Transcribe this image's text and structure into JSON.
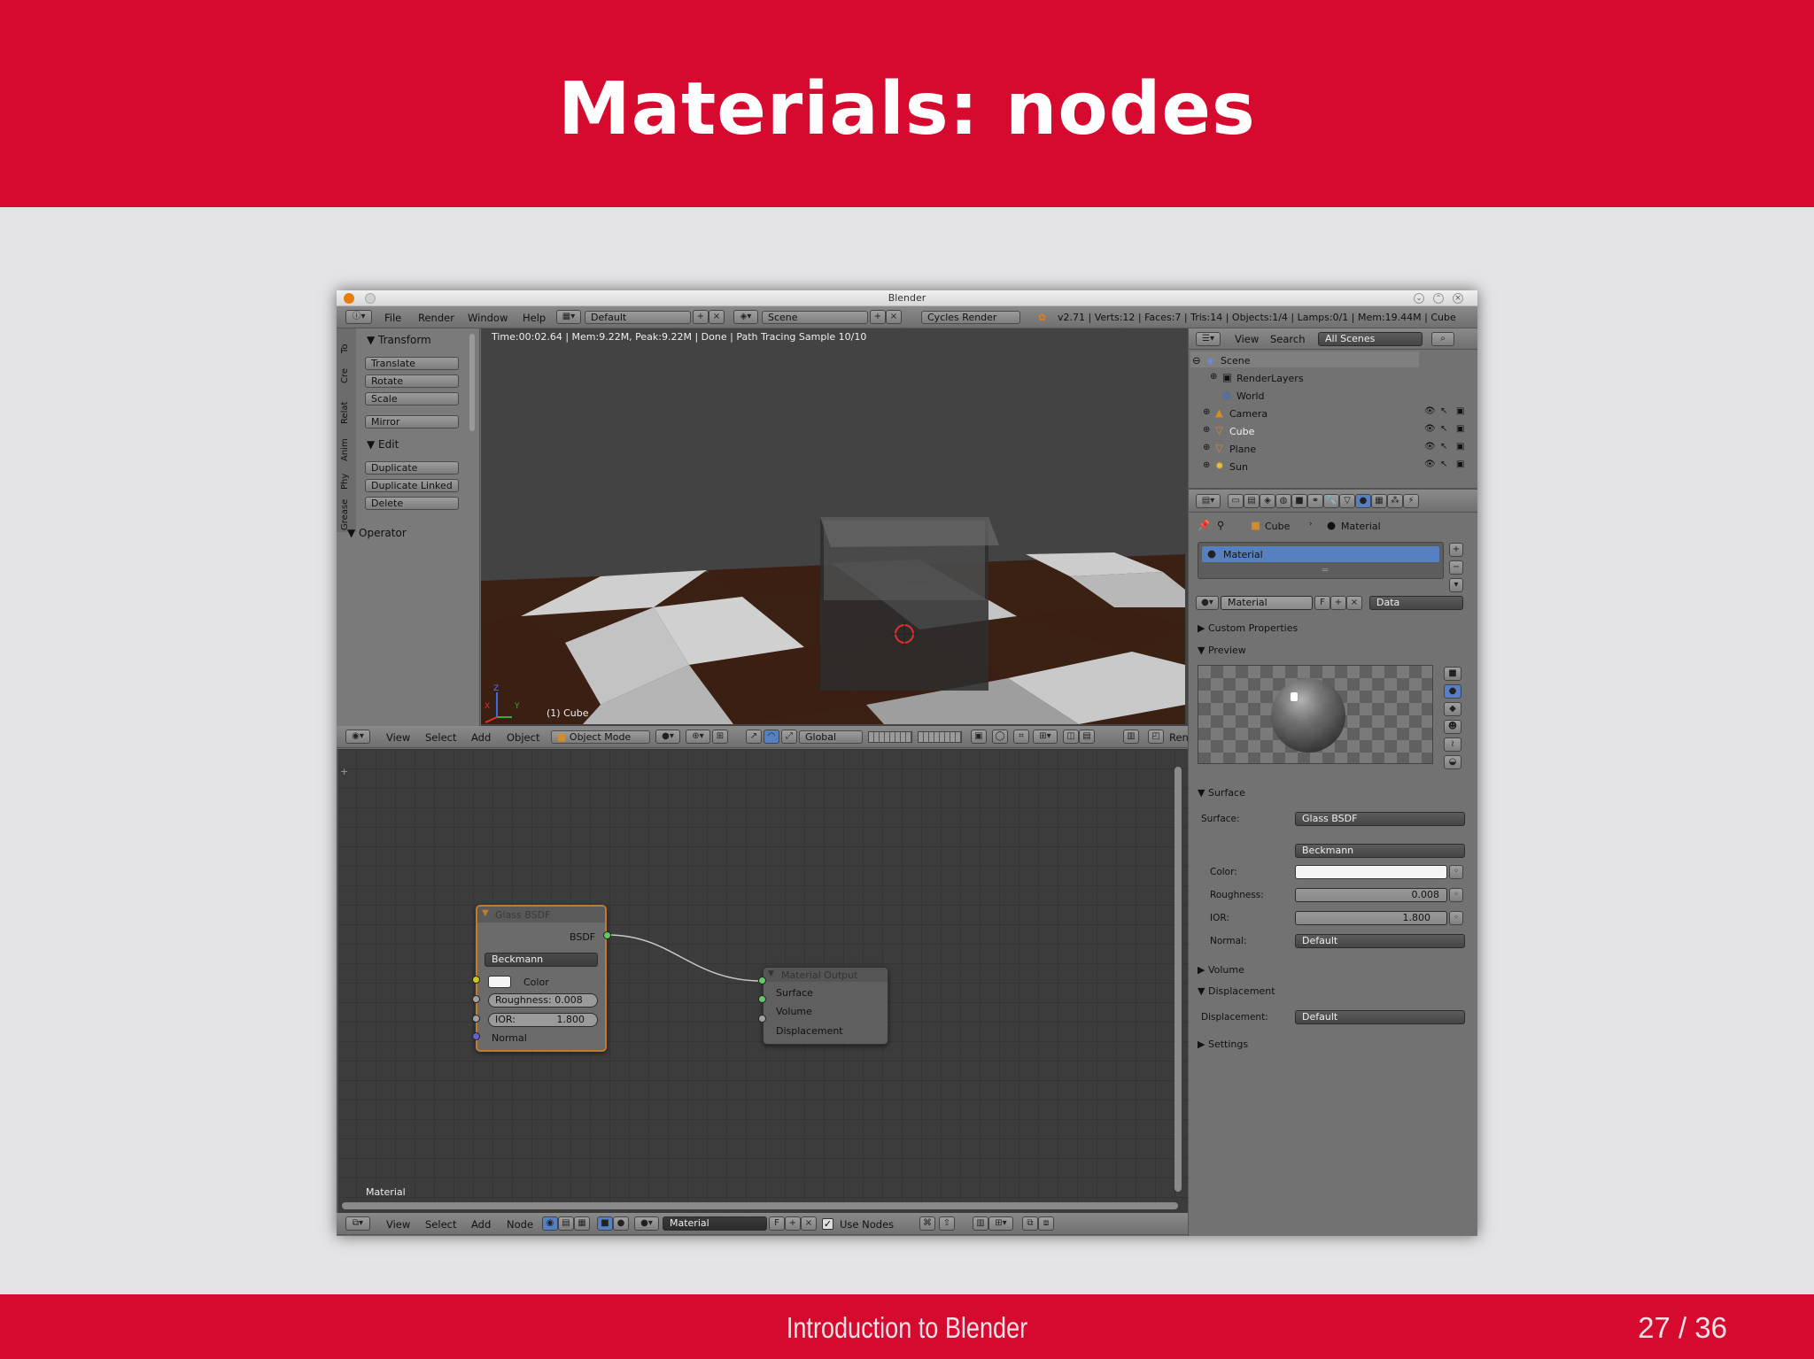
{
  "slide": {
    "title": "Materials: nodes",
    "footer": "Introduction to Blender",
    "page": "27 / 36"
  },
  "window": {
    "title": "Blender"
  },
  "topbar": {
    "menus": [
      "File",
      "Render",
      "Window",
      "Help"
    ],
    "layout": "Default",
    "scene": "Scene",
    "engine": "Cycles Render",
    "stats": "v2.71 | Verts:12 | Faces:7 | Tris:14 | Objects:1/4 | Lamps:0/1 | Mem:19.44M | Cube"
  },
  "toolshelf": {
    "tabs": [
      "To",
      "Cre",
      "Relat",
      "Anim",
      "Phy",
      "Grease"
    ],
    "transform_header": "Transform",
    "transform_buttons": [
      "Translate",
      "Rotate",
      "Scale"
    ],
    "mirror": "Mirror",
    "edit_header": "Edit",
    "edit_buttons": [
      "Duplicate",
      "Duplicate Linked",
      "Delete"
    ],
    "operator_header": "Operator"
  },
  "viewport": {
    "status": "Time:00:02.64 | Mem:9.22M, Peak:9.22M | Done | Path Tracing Sample 10/10",
    "object_label": "(1) Cube",
    "axis_labels": [
      "Z",
      "X",
      "Y"
    ],
    "header": {
      "menus": [
        "View",
        "Select",
        "Add",
        "Object"
      ],
      "mode": "Object Mode",
      "orientation": "Global",
      "render_cut": "Ren"
    }
  },
  "node_editor": {
    "glass": {
      "title": "Glass BSDF",
      "output": "BSDF",
      "distribution": "Beckmann",
      "color_label": "Color",
      "roughness_label": "Roughness:",
      "roughness": "0.008",
      "ior_label": "IOR:",
      "ior": "1.800",
      "normal_label": "Normal"
    },
    "output": {
      "title": "Material Output",
      "inputs": [
        "Surface",
        "Volume",
        "Displacement"
      ]
    },
    "material_label": "Material",
    "header": {
      "menus": [
        "View",
        "Select",
        "Add",
        "Node"
      ],
      "material": "Material",
      "f": "F",
      "use_nodes": "Use Nodes"
    }
  },
  "outliner": {
    "menus": [
      "View",
      "Search"
    ],
    "filter": "All Scenes",
    "items": [
      "Scene",
      "RenderLayers",
      "World",
      "Camera",
      "Cube",
      "Plane",
      "Sun"
    ]
  },
  "properties": {
    "breadcrumb": [
      "Cube",
      "Material"
    ],
    "slot": "Material",
    "datablock": {
      "name": "Material",
      "f": "F",
      "link": "Data"
    },
    "panels": {
      "custom": "Custom Properties",
      "preview": "Preview",
      "surface": "Surface",
      "volume": "Volume",
      "displacement": "Displacement",
      "settings": "Settings"
    },
    "surface": {
      "label": "Surface:",
      "shader": "Glass BSDF",
      "distribution": "Beckmann",
      "color_label": "Color:",
      "roughness_label": "Roughness:",
      "roughness": "0.008",
      "ior_label": "IOR:",
      "ior": "1.800",
      "normal_label": "Normal:",
      "normal": "Default"
    },
    "displacement": {
      "label": "Displacement:",
      "value": "Default"
    }
  },
  "colors": {
    "brand_red": "#d60a2e",
    "selection_blue": "#5680c2",
    "node_header": "#c27b2c",
    "socket_green": "#63c763",
    "socket_yellow": "#c7c729",
    "socket_gray": "#a1a1a1",
    "socket_blue": "#6363c7"
  }
}
